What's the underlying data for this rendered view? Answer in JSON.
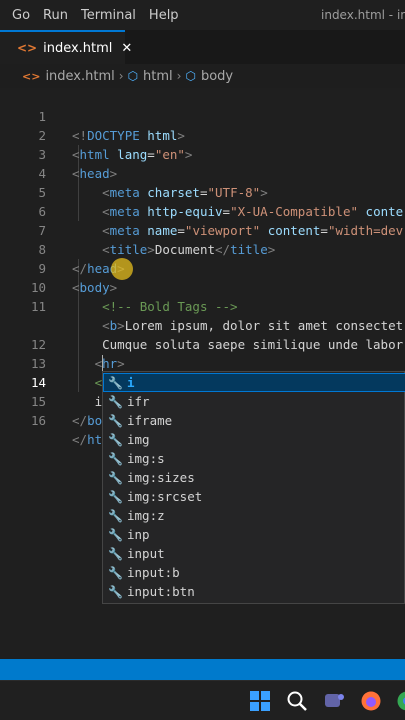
{
  "menubar": {
    "items": [
      "Go",
      "Run",
      "Terminal",
      "Help"
    ],
    "window_title": "index.html - ind"
  },
  "tab": {
    "label": "index.html",
    "close_glyph": "✕",
    "icon": "html-file-icon"
  },
  "breadcrumb": {
    "file": "index.html",
    "path": [
      "html",
      "body"
    ]
  },
  "editor": {
    "active_line": 14,
    "line_numbers": [
      "1",
      "2",
      "3",
      "4",
      "5",
      "6",
      "7",
      "8",
      "9",
      "10",
      "11",
      "",
      "12",
      "13",
      "14",
      "15",
      "16"
    ],
    "typed_text": "i"
  },
  "suggestions": {
    "typed": "i",
    "items": [
      "i",
      "ifr",
      "iframe",
      "img",
      "img:s",
      "img:sizes",
      "img:srcset",
      "img:z",
      "inp",
      "input",
      "input:b",
      "input:btn"
    ],
    "selected_index": 0
  },
  "colors": {
    "accent": "#0078d4",
    "statusbar": "#007acc",
    "tag": "#569cd6",
    "attr": "#9cdcfe",
    "string": "#ce9178",
    "comment": "#6a9955"
  }
}
